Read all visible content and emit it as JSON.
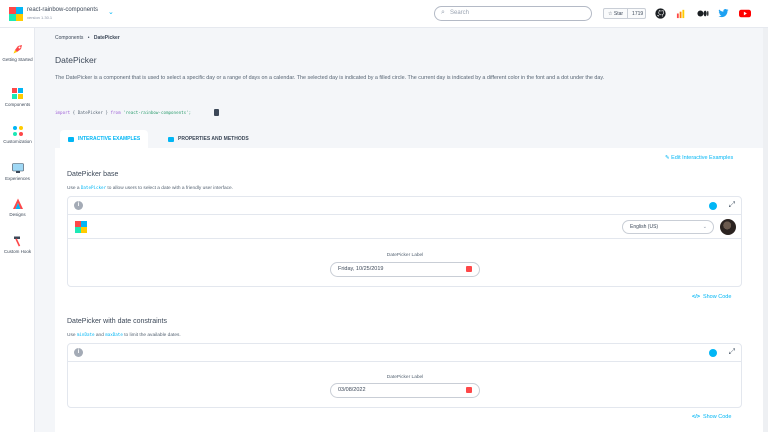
{
  "app": {
    "name": "react-rainbow-components",
    "version": "version 1.30.1"
  },
  "header": {
    "search_placeholder": "Search",
    "star_label": "Star",
    "star_count": "1719",
    "social_icons": [
      "github-icon",
      "storybook-icon",
      "medium-icon",
      "twitter-icon",
      "youtube-icon"
    ]
  },
  "sidebar": {
    "items": [
      {
        "label": "Getting Started",
        "icon": "rocket-icon"
      },
      {
        "label": "Components",
        "icon": "components-icon"
      },
      {
        "label": "Customization",
        "icon": "customization-icon"
      },
      {
        "label": "Experiences",
        "icon": "experiences-icon"
      },
      {
        "label": "Designs",
        "icon": "designs-icon"
      },
      {
        "label": "Custom Hook",
        "icon": "hammer-icon"
      }
    ]
  },
  "breadcrumb": {
    "parent": "Components",
    "separator": "•",
    "current": "DatePicker"
  },
  "page": {
    "title": "DatePicker",
    "description": "The DatePicker is a component that is used to select a specific day or a range of days on a calendar. The selected day is indicated by a filled circle. The current day is indicated by a different color in the font and a dot under the day.",
    "import_kw1": "import",
    "import_name": "{ DatePicker }",
    "import_kw2": "from",
    "import_str": "'react-rainbow-components';"
  },
  "tabs": [
    {
      "label": "INTERACTIVE EXAMPLES",
      "active": true
    },
    {
      "label": "PROPERTIES AND METHODS",
      "active": false
    }
  ],
  "edit_link": "Edit Interactive Examples",
  "examples": [
    {
      "title": "DatePicker base",
      "sub_pre": "Use a ",
      "sub_code": "DatePicker",
      "sub_post": " to allow users to select a date with a friendly user interface.",
      "language": "English (US)",
      "field_label": "DatePicker Label",
      "value": "Friday, 10/25/2019",
      "show_code": "Show Code"
    },
    {
      "title": "DatePicker with date constraints",
      "sub_pre": "Use ",
      "sub_code": "minDate",
      "sub_mid": " and ",
      "sub_code2": "maxDate",
      "sub_post": " to limit the available dates.",
      "field_label": "DatePicker Label",
      "value": "03/08/2022",
      "show_code": "Show Code"
    }
  ],
  "colors": {
    "accent": "#01b6f5",
    "brand_red": "#fe4849",
    "brand_green": "#1de9b6",
    "brand_yellow": "#ffcc00"
  }
}
